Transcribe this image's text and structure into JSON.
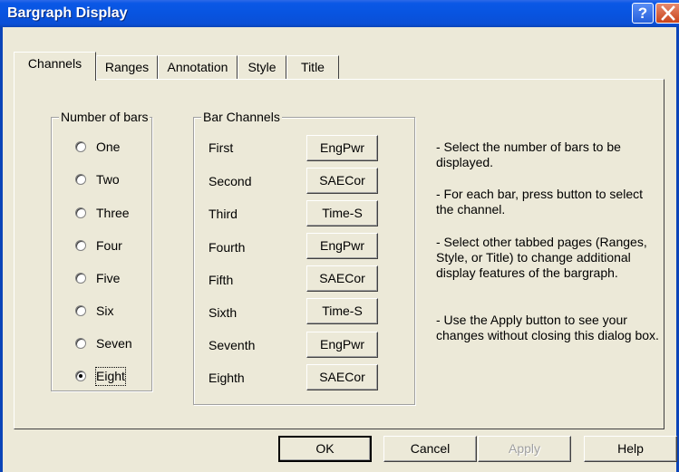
{
  "window": {
    "title": "Bargraph Display",
    "help_glyph": "?",
    "close_glyph": "X"
  },
  "tabs": [
    {
      "label": "Channels",
      "active": true
    },
    {
      "label": "Ranges",
      "active": false
    },
    {
      "label": "Annotation",
      "active": false
    },
    {
      "label": "Style",
      "active": false
    },
    {
      "label": "Title",
      "active": false
    }
  ],
  "number_of_bars": {
    "label": "Number of bars",
    "options": [
      "One",
      "Two",
      "Three",
      "Four",
      "Five",
      "Six",
      "Seven",
      "Eight"
    ],
    "selected": "Eight"
  },
  "bar_channels": {
    "label": "Bar Channels",
    "rows": [
      {
        "label": "First",
        "channel": "EngPwr"
      },
      {
        "label": "Second",
        "channel": "SAECor"
      },
      {
        "label": "Third",
        "channel": "Time-S"
      },
      {
        "label": "Fourth",
        "channel": "EngPwr"
      },
      {
        "label": "Fifth",
        "channel": "SAECor"
      },
      {
        "label": "Sixth",
        "channel": "Time-S"
      },
      {
        "label": "Seventh",
        "channel": "EngPwr"
      },
      {
        "label": "Eighth",
        "channel": "SAECor"
      }
    ]
  },
  "help_text": [
    "- Select the number of bars to be displayed.",
    "- For each bar, press button to select the channel.",
    "- Select other tabbed pages (Ranges, Style, or Title) to change additional display features of the bargraph.",
    "- Use the Apply button to see your changes without closing this dialog box."
  ],
  "buttons": {
    "ok": "OK",
    "cancel": "Cancel",
    "apply": "Apply",
    "help": "Help"
  },
  "colors": {
    "titlebar": "#0854e0",
    "dialog_bg": "#ece9d8"
  }
}
